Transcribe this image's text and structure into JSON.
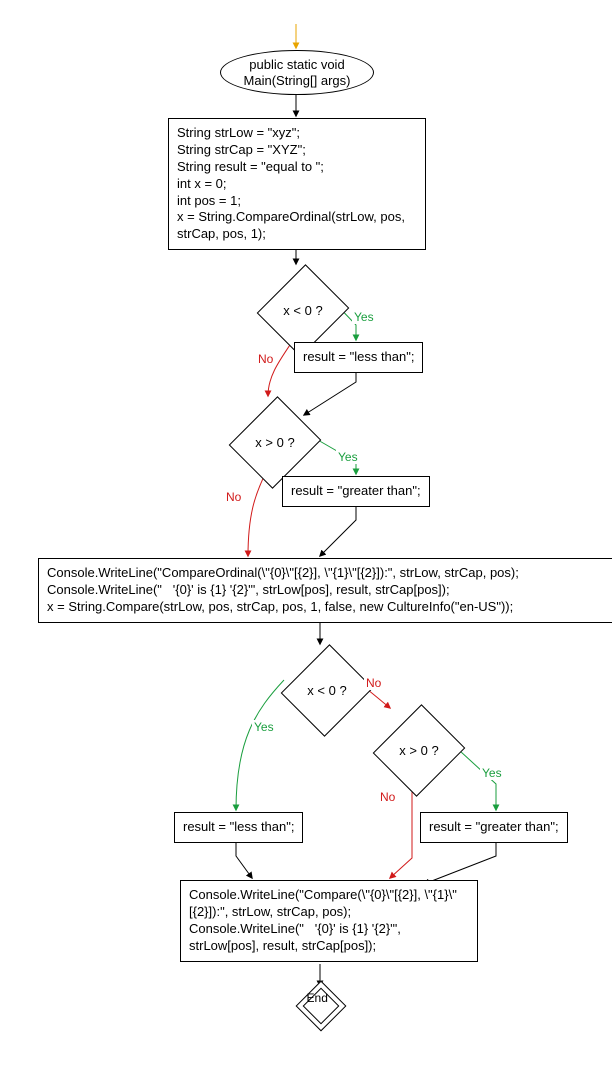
{
  "chart_data": {
    "type": "flowchart",
    "title": "",
    "nodes": [
      {
        "id": "start",
        "shape": "terminal",
        "text": "public static void\nMain(String[] args)"
      },
      {
        "id": "init",
        "shape": "process",
        "text": "String strLow = \"xyz\";\nString strCap = \"XYZ\";\nString result = \"equal to \";\nint x = 0;\nint pos = 1;\nx = String.CompareOrdinal(strLow, pos, strCap, pos, 1);"
      },
      {
        "id": "d1",
        "shape": "decision",
        "text": "x < 0 ?"
      },
      {
        "id": "a1",
        "shape": "process",
        "text": "result = \"less than\";"
      },
      {
        "id": "d2",
        "shape": "decision",
        "text": "x > 0 ?"
      },
      {
        "id": "a2",
        "shape": "process",
        "text": "result = \"greater than\";"
      },
      {
        "id": "out1",
        "shape": "process",
        "text": "Console.WriteLine(\"CompareOrdinal(\\\"{0}\\\"[{2}], \\\"{1}\\\"[{2}]):\", strLow, strCap, pos);\nConsole.WriteLine(\"   '{0}' is {1} '{2}'\", strLow[pos], result, strCap[pos]);\nx = String.Compare(strLow, pos, strCap, pos, 1, false, new CultureInfo(\"en-US\"));"
      },
      {
        "id": "d3",
        "shape": "decision",
        "text": "x < 0 ?"
      },
      {
        "id": "d4",
        "shape": "decision",
        "text": "x > 0 ?"
      },
      {
        "id": "a3",
        "shape": "process",
        "text": "result = \"less than\";"
      },
      {
        "id": "a4",
        "shape": "process",
        "text": "result = \"greater than\";"
      },
      {
        "id": "out2",
        "shape": "process",
        "text": "Console.WriteLine(\"Compare(\\\"{0}\\\"[{2}], \\\"{1}\\\"[{2}]):\", strLow, strCap, pos);\nConsole.WriteLine(\"   '{0}' is {1} '{2}'\", strLow[pos], result, strCap[pos]);"
      },
      {
        "id": "end",
        "shape": "end",
        "text": "End"
      }
    ],
    "edges": [
      {
        "from": "start",
        "to": "init"
      },
      {
        "from": "init",
        "to": "d1"
      },
      {
        "from": "d1",
        "to": "a1",
        "label": "Yes"
      },
      {
        "from": "d1",
        "to": "d2",
        "label": "No"
      },
      {
        "from": "a1",
        "to": "d2"
      },
      {
        "from": "d2",
        "to": "a2",
        "label": "Yes"
      },
      {
        "from": "d2",
        "to": "out1",
        "label": "No"
      },
      {
        "from": "a2",
        "to": "out1"
      },
      {
        "from": "out1",
        "to": "d3"
      },
      {
        "from": "d3",
        "to": "a3",
        "label": "Yes"
      },
      {
        "from": "d3",
        "to": "d4",
        "label": "No"
      },
      {
        "from": "d4",
        "to": "a4",
        "label": "Yes"
      },
      {
        "from": "d4",
        "to": "out2",
        "label": "No"
      },
      {
        "from": "a3",
        "to": "out2"
      },
      {
        "from": "a4",
        "to": "out2"
      },
      {
        "from": "out2",
        "to": "end"
      }
    ],
    "labels": {
      "yes": "Yes",
      "no": "No"
    },
    "colors": {
      "yes": "#1a9e3e",
      "no": "#d11a1a",
      "entry_arrow": "#e8a400"
    }
  }
}
